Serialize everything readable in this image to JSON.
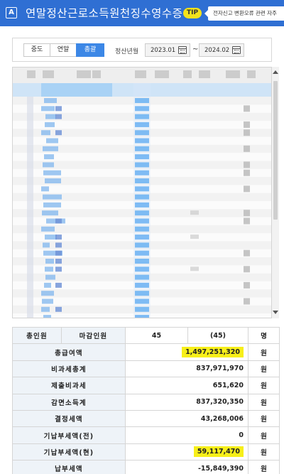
{
  "titlebar": {
    "badge": "A",
    "title": "연말정산근로소득원천징수영수증",
    "tip_badge": "TIP",
    "tip_text": "전자신고 변환오류 관련 자주"
  },
  "filters": {
    "segments": [
      "중도",
      "연말",
      "총괄"
    ],
    "active_segment": "총괄",
    "period_label": "정산년월",
    "date_from": "2023.01",
    "date_separator": "~",
    "date_to": "2024.02"
  },
  "summary": {
    "header": {
      "total_label": "총인원",
      "closed_label": "마감인원",
      "closed_count": "45",
      "closed_count_paren": "(45)",
      "unit": "명"
    },
    "rows": [
      {
        "label": "총급여액",
        "value": "1,497,251,320",
        "unit": "원",
        "highlight": true
      },
      {
        "label": "비과세총계",
        "value": "837,971,970",
        "unit": "원",
        "highlight": false
      },
      {
        "label": "제출비과세",
        "value": "651,620",
        "unit": "원",
        "highlight": false
      },
      {
        "label": "감면소득계",
        "value": "837,320,350",
        "unit": "원",
        "highlight": false
      },
      {
        "label": "결정세액",
        "value": "43,268,006",
        "unit": "원",
        "highlight": false
      },
      {
        "label": "기납부세액(전)",
        "value": "0",
        "unit": "원",
        "highlight": false
      },
      {
        "label": "기납부세액(현)",
        "value": "59,117,470",
        "unit": "원",
        "highlight": true
      },
      {
        "label": "납부세액",
        "value": "-15,849,390",
        "unit": "원",
        "highlight": false
      }
    ]
  },
  "colors": {
    "titlebar": "#2f6fd3",
    "active_tab": "#3c87e6",
    "highlight": "#f7ef19"
  }
}
